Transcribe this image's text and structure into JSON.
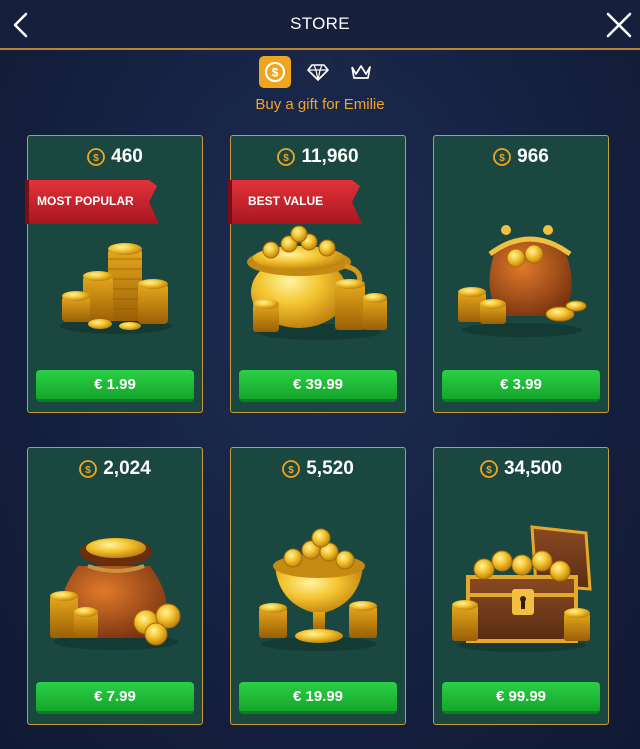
{
  "header": {
    "title": "STORE"
  },
  "tabs": [
    {
      "name": "coins-tab",
      "icon": "coin-icon",
      "active": true
    },
    {
      "name": "diamonds-tab",
      "icon": "diamond-icon",
      "active": false
    },
    {
      "name": "vip-tab",
      "icon": "crown-icon",
      "active": false
    }
  ],
  "subtitle": "Buy a gift for Emilie",
  "colors": {
    "accent": "#f0a521",
    "card_bg": "#1a4740",
    "buy_green": "#1fbf38",
    "ribbon_red": "#c8202a",
    "card_border": "#c79a3c"
  },
  "products": [
    {
      "amount": "460",
      "price": "€ 1.99",
      "badge": "MOST POPULAR",
      "art": "coin-stacks-icon"
    },
    {
      "amount": "11,960",
      "price": "€ 39.99",
      "badge": "BEST VALUE",
      "art": "gold-pot-icon"
    },
    {
      "amount": "966",
      "price": "€ 3.99",
      "badge": "",
      "art": "coin-purse-icon"
    },
    {
      "amount": "2,024",
      "price": "€ 7.99",
      "badge": "",
      "art": "coin-sack-icon"
    },
    {
      "amount": "5,520",
      "price": "€ 19.99",
      "badge": "",
      "art": "gold-chalice-icon"
    },
    {
      "amount": "34,500",
      "price": "€ 99.99",
      "badge": "",
      "art": "treasure-chest-icon"
    }
  ]
}
